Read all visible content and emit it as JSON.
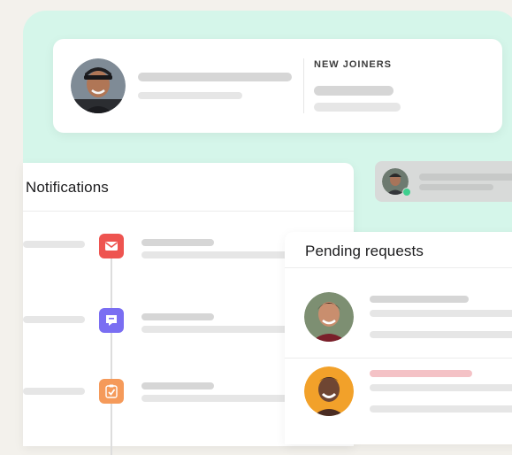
{
  "new_joiners": {
    "heading": "NEW JOINERS"
  },
  "notifications": {
    "heading": "Notifications",
    "items": [
      {
        "icon": "mail-icon",
        "color": "#ee5450"
      },
      {
        "icon": "chat-icon",
        "color": "#7a6ef2"
      },
      {
        "icon": "clipboard-check-icon",
        "color": "#f59a5a"
      }
    ]
  },
  "pending_requests": {
    "heading": "Pending requests"
  },
  "colors": {
    "background": "#f3f1ec",
    "mint": "#d5f6ea",
    "placeholder": "#e6e6e6",
    "accent_pink": "#f4c2c6",
    "online_dot": "#3ecf8e"
  }
}
